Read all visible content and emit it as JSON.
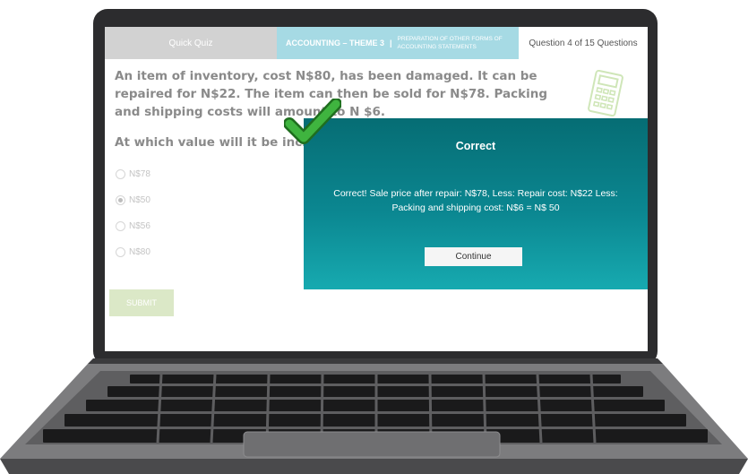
{
  "quiz": {
    "tab_label": "Quick Quiz",
    "theme_label": "ACCOUNTING – THEME 3",
    "separator": "|",
    "subtopic": "PREPARATION OF OTHER FORMS OF ACCOUNTING STATEMENTS",
    "progress": "Question 4 of 15 Questions"
  },
  "question": {
    "text": "An item of inventory, cost N$80, has been damaged. It can be repaired for N$22. The item can then be sold for N$78. Packing and shipping costs will amount to N $6.",
    "prompt": "At which value will it be included in"
  },
  "options": [
    {
      "label": "N$78",
      "selected": false
    },
    {
      "label": "N$50",
      "selected": true
    },
    {
      "label": "N$56",
      "selected": false
    },
    {
      "label": "N$80",
      "selected": false
    }
  ],
  "submit_label": "SUBMIT",
  "popup": {
    "title": "Correct",
    "message": "Correct! Sale price after repair: N$78, Less: Repair cost: N$22 Less: Packing and shipping cost: N$6 = N$ 50",
    "button": "Continue"
  },
  "colors": {
    "popup_top": "#066d74",
    "popup_bottom": "#17aab0",
    "theme_bar": "#a6dae4",
    "check_green": "#2e9e2e"
  }
}
